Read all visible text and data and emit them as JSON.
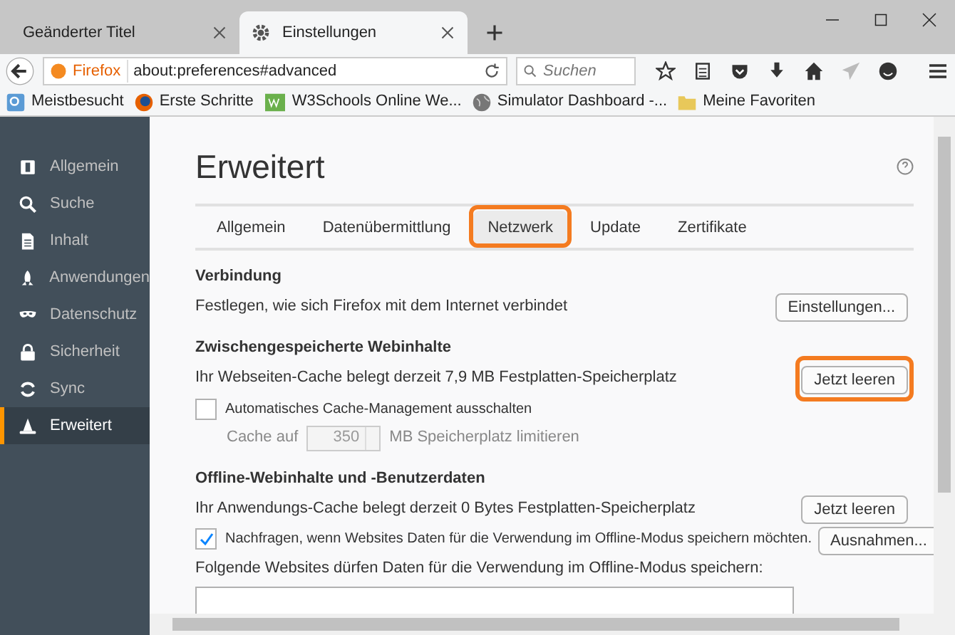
{
  "browser_tabs": [
    {
      "title": "Geänderter Titel",
      "selected": false
    },
    {
      "title": "Einstellungen",
      "selected": true
    }
  ],
  "nav": {
    "identity": "Firefox",
    "url": "about:preferences#advanced",
    "search_placeholder": "Suchen"
  },
  "bookmarks": [
    {
      "kind": "blue",
      "label": "Meistbesucht"
    },
    {
      "kind": "fox",
      "label": "Erste Schritte"
    },
    {
      "kind": "w3",
      "label": "W3Schools Online We..."
    },
    {
      "kind": "globe",
      "label": "Simulator Dashboard -..."
    },
    {
      "kind": "folder",
      "label": "Meine Favoriten"
    }
  ],
  "sidebar": {
    "items": [
      {
        "label": "Allgemein",
        "selected": false
      },
      {
        "label": "Suche",
        "selected": false
      },
      {
        "label": "Inhalt",
        "selected": false
      },
      {
        "label": "Anwendungen",
        "selected": false
      },
      {
        "label": "Datenschutz",
        "selected": false
      },
      {
        "label": "Sicherheit",
        "selected": false
      },
      {
        "label": "Sync",
        "selected": false
      },
      {
        "label": "Erweitert",
        "selected": true
      }
    ]
  },
  "page": {
    "title": "Erweitert",
    "tabs": [
      {
        "label": "Allgemein",
        "selected": false,
        "highlighted": false
      },
      {
        "label": "Datenübermittlung",
        "selected": false,
        "highlighted": false
      },
      {
        "label": "Netzwerk",
        "selected": true,
        "highlighted": true
      },
      {
        "label": "Update",
        "selected": false,
        "highlighted": false
      },
      {
        "label": "Zertifikate",
        "selected": false,
        "highlighted": false
      }
    ],
    "sections": [
      {
        "heading": "Verbindung",
        "rows": [
          {
            "kind": "text",
            "text": "Festlegen, wie sich Firefox mit dem Internet verbindet",
            "button": "Einstellungen...",
            "highlighted": false
          }
        ]
      },
      {
        "heading": "Zwischengespeicherte Webinhalte",
        "rows": [
          {
            "kind": "text",
            "text": "Ihr Webseiten-Cache belegt derzeit 7,9 MB Festplatten-Speicherplatz",
            "button": "Jetzt leeren",
            "highlighted": true
          },
          {
            "kind": "checkbox",
            "text": "Automatisches Cache-Management ausschalten",
            "checked": false
          },
          {
            "kind": "spin",
            "before": "Cache auf",
            "value": "350",
            "after": "MB Speicherplatz limitieren",
            "disabled": true
          }
        ]
      },
      {
        "heading": "Offline-Webinhalte und -Benutzerdaten",
        "rows": [
          {
            "kind": "text",
            "text": "Ihr Anwendungs-Cache belegt derzeit 0 Bytes Festplatten-Speicherplatz",
            "button": "Jetzt leeren",
            "highlighted": false
          },
          {
            "kind": "checkbox",
            "text": "Nachfragen, wenn Websites Daten für die Verwendung im Offline-Modus speichern möchten.",
            "checked": true,
            "button": "Ausnahmen..."
          },
          {
            "kind": "list",
            "text": "Folgende Websites dürfen Daten für die Verwendung im Offline-Modus speichern:"
          }
        ]
      }
    ]
  }
}
